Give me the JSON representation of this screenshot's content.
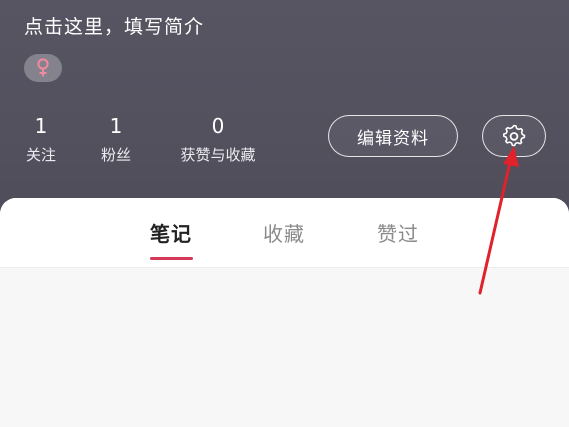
{
  "profile": {
    "bio_placeholder": "点击这里，填写简介",
    "gender_icon": "female-symbol-icon"
  },
  "stats": [
    {
      "value": "1",
      "label": "关注"
    },
    {
      "value": "1",
      "label": "粉丝"
    },
    {
      "value": "0",
      "label": "获赞与收藏"
    }
  ],
  "actions": {
    "edit_label": "编辑资料",
    "settings_icon": "gear-icon"
  },
  "tabs": [
    {
      "label": "笔记",
      "active": true
    },
    {
      "label": "收藏",
      "active": false
    },
    {
      "label": "赞过",
      "active": false
    }
  ],
  "colors": {
    "header_bg": "#53515e",
    "accent": "#d23a55",
    "annotation_arrow": "#e0222b",
    "female_icon": "#f08aa0"
  }
}
